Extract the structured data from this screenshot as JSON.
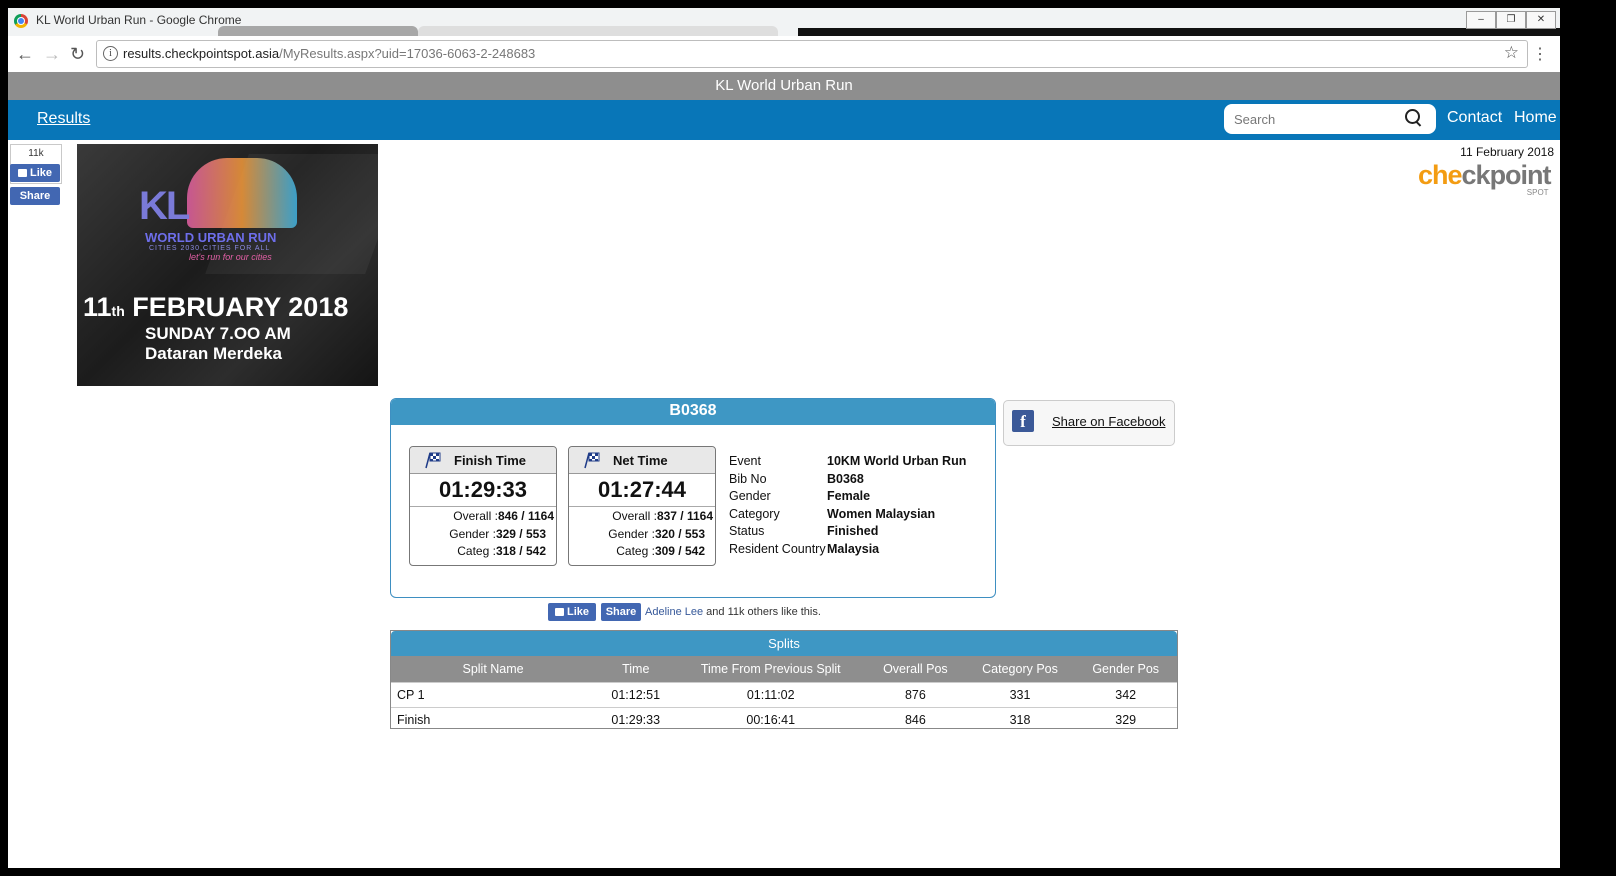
{
  "window": {
    "title": "KL World Urban Run - Google Chrome"
  },
  "address": {
    "host": "results.checkpointspot.asia",
    "path": "/MyResults.aspx?uid=17036-6063-2-248683"
  },
  "site": {
    "title": "KL World Urban Run"
  },
  "nav": {
    "results": "Results",
    "search_placeholder": "Search",
    "contact": "Contact",
    "home": "Home"
  },
  "fb_widget": {
    "count": "11k",
    "like": "Like",
    "share": "Share"
  },
  "banner": {
    "logo": "KL",
    "name": "WORLD URBAN RUN",
    "subtitle": "CITIES 2030,CITIES FOR ALL",
    "tagline": "let's run for our cities",
    "date_day": "11",
    "date_suffix": "th",
    "date_rest": "FEBRUARY 2018",
    "day_time": "SUNDAY 7.OO AM",
    "place": "Dataran Merdeka"
  },
  "page_date": "11 February 2018",
  "brand": {
    "part1": "che",
    "part2": "ckpoint",
    "spot": "SPOT"
  },
  "result": {
    "bib": "B0368",
    "finish": {
      "label": "Finish Time",
      "time": "01:29:33",
      "overall_label": "Overall :",
      "overall": "846 / 1164",
      "gender_label": "Gender :",
      "gender": "329 / 553",
      "categ_label": "Categ :",
      "categ": "318 / 542"
    },
    "net": {
      "label": "Net Time",
      "time": "01:27:44",
      "overall_label": "Overall :",
      "overall": "837 / 1164",
      "gender_label": "Gender :",
      "gender": "320 / 553",
      "categ_label": "Categ :",
      "categ": "309 / 542"
    },
    "details": [
      {
        "k": "Event",
        "v": "10KM World Urban Run"
      },
      {
        "k": "Bib No",
        "v": "B0368"
      },
      {
        "k": "Gender",
        "v": "Female"
      },
      {
        "k": "Category",
        "v": "Women Malaysian"
      },
      {
        "k": "Status",
        "v": "Finished"
      },
      {
        "k": "Resident Country",
        "v": "Malaysia"
      }
    ]
  },
  "share_fb": "Share on Facebook",
  "likeline": {
    "like": "Like",
    "share": "Share",
    "name": "Adeline Lee",
    "rest": "and 11k others like this."
  },
  "splits": {
    "title": "Splits",
    "headers": [
      "Split Name",
      "Time",
      "Time From Previous Split",
      "Overall Pos",
      "Category Pos",
      "Gender Pos"
    ],
    "rows": [
      [
        "CP 1",
        "01:12:51",
        "01:11:02",
        "876",
        "331",
        "342"
      ],
      [
        "Finish",
        "01:29:33",
        "00:16:41",
        "846",
        "318",
        "329"
      ]
    ]
  }
}
